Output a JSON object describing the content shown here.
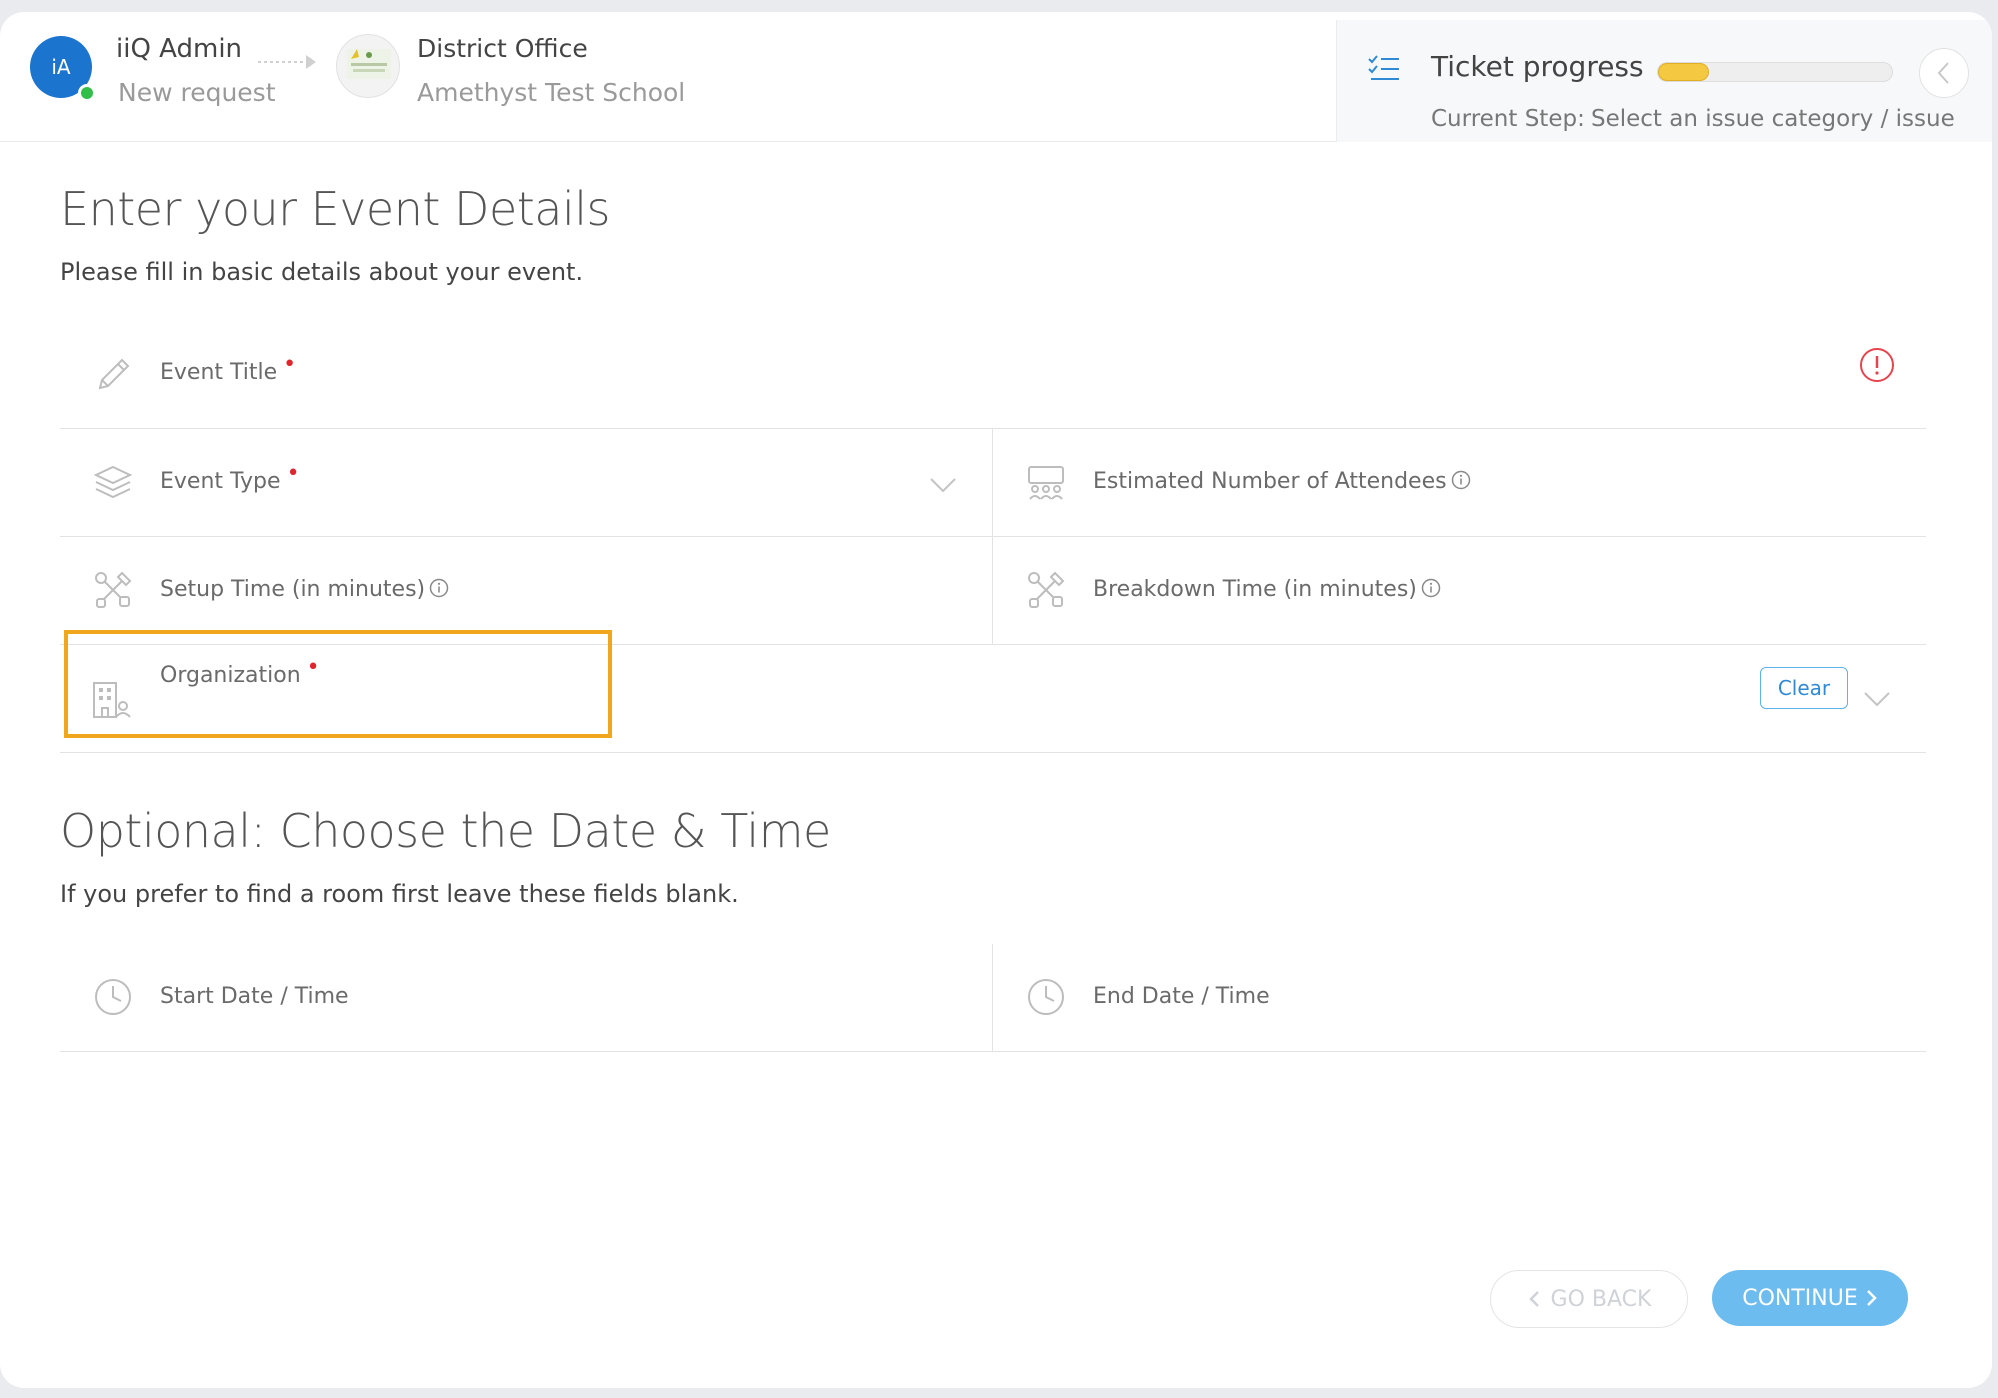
{
  "header": {
    "avatar_initials": "iA",
    "requester_name": "iiQ Admin",
    "request_type": "New request",
    "location_name": "District Office",
    "school_name": "Amethyst Test School"
  },
  "progress": {
    "title": "Ticket progress",
    "percent": 22,
    "current_step_label": "Current Step:",
    "current_step_value": "Select an issue category / issue"
  },
  "event_details": {
    "title": "Enter your Event Details",
    "subtitle": "Please fill in basic details about your event.",
    "fields": {
      "event_title": {
        "label": "Event Title",
        "required": true,
        "icon": "pencil-icon"
      },
      "event_type": {
        "label": "Event Type",
        "required": true,
        "icon": "layers-icon"
      },
      "attendees": {
        "label": "Estimated Number of Attendees",
        "icon": "audience-icon"
      },
      "setup_time": {
        "label": "Setup Time (in minutes)",
        "icon": "tools-icon"
      },
      "breakdown_time": {
        "label": "Breakdown Time (in minutes)",
        "icon": "tools-icon"
      },
      "organization": {
        "label": "Organization",
        "required": true,
        "icon": "building-icon",
        "clear_label": "Clear"
      }
    }
  },
  "date_time": {
    "title": "Optional: Choose the Date & Time",
    "subtitle": "If you prefer to find a room first leave these fields blank.",
    "start_label": "Start Date / Time",
    "end_label": "End Date / Time"
  },
  "footer": {
    "back_label": "GO BACK",
    "continue_label": "CONTINUE"
  },
  "colors": {
    "primary": "#1b74cd",
    "continue": "#6cbcf0",
    "highlight": "#f0a61d",
    "required": "#e0262d",
    "progress_fill": "#f5c842"
  }
}
